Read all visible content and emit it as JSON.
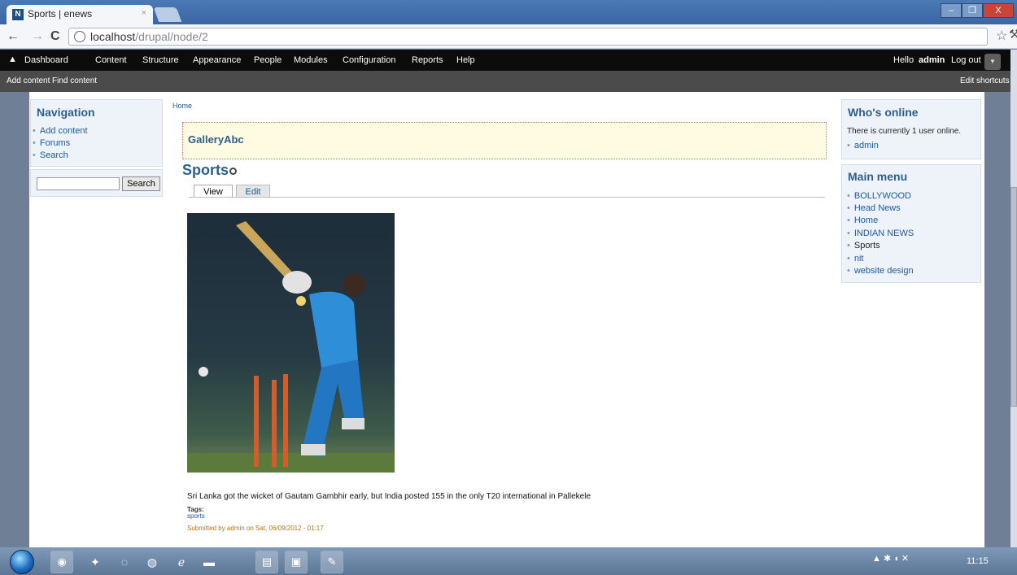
{
  "browser": {
    "tab_title": "Sports | enews",
    "tab_favicon": "N",
    "tab_close": "×",
    "back": "←",
    "forward": "→",
    "reload": "C",
    "url_host": "localhost",
    "url_path": "/drupal/node/2",
    "bookmark_star": "☆",
    "wrench": "🔧",
    "win_min": "–",
    "win_max": "❐",
    "win_close": "X"
  },
  "drupal_toolbar": {
    "home_icon": "home-icon",
    "menu": [
      "Dashboard",
      "Content",
      "Structure",
      "Appearance",
      "People",
      "Modules",
      "Configuration",
      "Reports",
      "Help"
    ],
    "hello_prefix": "Hello",
    "username": "admin",
    "logout": "Log out",
    "shortcuts": [
      "Add content",
      "Find content"
    ],
    "edit_shortcuts": "Edit shortcuts"
  },
  "sidebar_left": {
    "navigation_title": "Navigation",
    "navigation_items": [
      "Add content",
      "Forums",
      "Search"
    ],
    "search_button": "Search",
    "search_value": ""
  },
  "main": {
    "breadcrumb": "Home",
    "gallery_title": "GalleryAbc",
    "page_title": "Sports",
    "tabs": [
      "View",
      "Edit"
    ],
    "caption": "Sri Lanka got the wicket of Gautam Gambhir early, but India posted 155 in the only T20 international in Pallekele",
    "tags_label": "Tags:",
    "tag_value": "sports",
    "submitted": "Submitted by admin on Sat, 06/09/2012 - 01:17"
  },
  "sidebar_right": {
    "whos_online_title": "Who's online",
    "whos_online_text": "There is currently 1 user online.",
    "online_users": [
      "admin"
    ],
    "main_menu_title": "Main menu",
    "main_menu_items": [
      "BOLLYWOOD",
      "Head News",
      "Home",
      "INDIAN NEWS",
      "Sports",
      "nit",
      "website design"
    ]
  },
  "taskbar": {
    "clock": "11:15"
  },
  "colors": {
    "accent": "#2c5f8f",
    "link": "#1c5aa8",
    "drupal_toolbar_bg": "#0c0c0c",
    "shortcuts_bg": "#4b4b4b"
  }
}
